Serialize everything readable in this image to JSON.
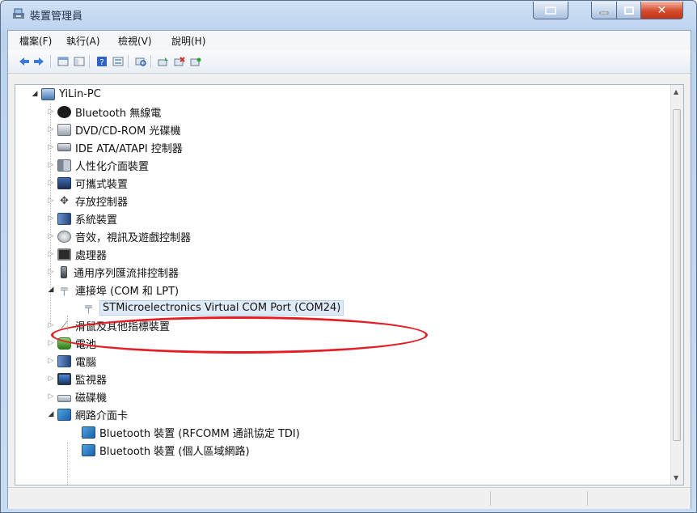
{
  "window": {
    "title": "裝置管理員"
  },
  "menu": [
    "檔案(F)",
    "執行(A)",
    "檢視(V)",
    "說明(H)"
  ],
  "toolbar": [
    "back-icon",
    "forward-icon",
    "show-hide-console-icon",
    "console-tree-icon",
    "help-icon",
    "properties-icon",
    "scan-hardware-icon",
    "update-driver-icon",
    "disable-device-icon",
    "uninstall-device-icon"
  ],
  "tree": {
    "root": "YiLin-PC",
    "items": [
      {
        "label": "Bluetooth 無線電",
        "icon": "bluetooth-icon",
        "expanded": false
      },
      {
        "label": "DVD/CD-ROM 光碟機",
        "icon": "dvd-drive-icon",
        "expanded": false
      },
      {
        "label": "IDE ATA/ATAPI 控制器",
        "icon": "ide-controller-icon",
        "expanded": false
      },
      {
        "label": "人性化介面裝置",
        "icon": "hid-icon",
        "expanded": false
      },
      {
        "label": "可攜式裝置",
        "icon": "portable-device-icon",
        "expanded": false
      },
      {
        "label": "存放控制器",
        "icon": "storage-controller-icon",
        "expanded": false
      },
      {
        "label": "系統裝置",
        "icon": "system-device-icon",
        "expanded": false
      },
      {
        "label": "音效，視訊及遊戲控制器",
        "icon": "sound-icon",
        "expanded": false
      },
      {
        "label": "處理器",
        "icon": "processor-icon",
        "expanded": false
      },
      {
        "label": "通用序列匯流排控制器",
        "icon": "usb-icon",
        "expanded": false
      },
      {
        "label": "連接埠 (COM 和 LPT)",
        "icon": "port-icon",
        "expanded": true,
        "children": [
          {
            "label": "STMicroelectronics Virtual COM Port (COM24)",
            "icon": "port-icon",
            "selected": true
          }
        ]
      },
      {
        "label": "滑鼠及其他指標裝置",
        "icon": "mouse-icon",
        "expanded": false
      },
      {
        "label": "電池",
        "icon": "battery-icon",
        "expanded": false
      },
      {
        "label": "電腦",
        "icon": "computer-icon",
        "expanded": false
      },
      {
        "label": "監視器",
        "icon": "monitor-icon",
        "expanded": false
      },
      {
        "label": "磁碟機",
        "icon": "disk-drive-icon",
        "expanded": false
      },
      {
        "label": "網路介面卡",
        "icon": "network-adapter-icon",
        "expanded": true,
        "children": [
          {
            "label": "Bluetooth 裝置 (RFCOMM 通訊協定 TDI)",
            "icon": "network-adapter-icon"
          },
          {
            "label": "Bluetooth 裝置 (個人區域網路)",
            "icon": "network-adapter-icon"
          }
        ]
      }
    ]
  },
  "annotation": {
    "color": "#e31e24"
  }
}
